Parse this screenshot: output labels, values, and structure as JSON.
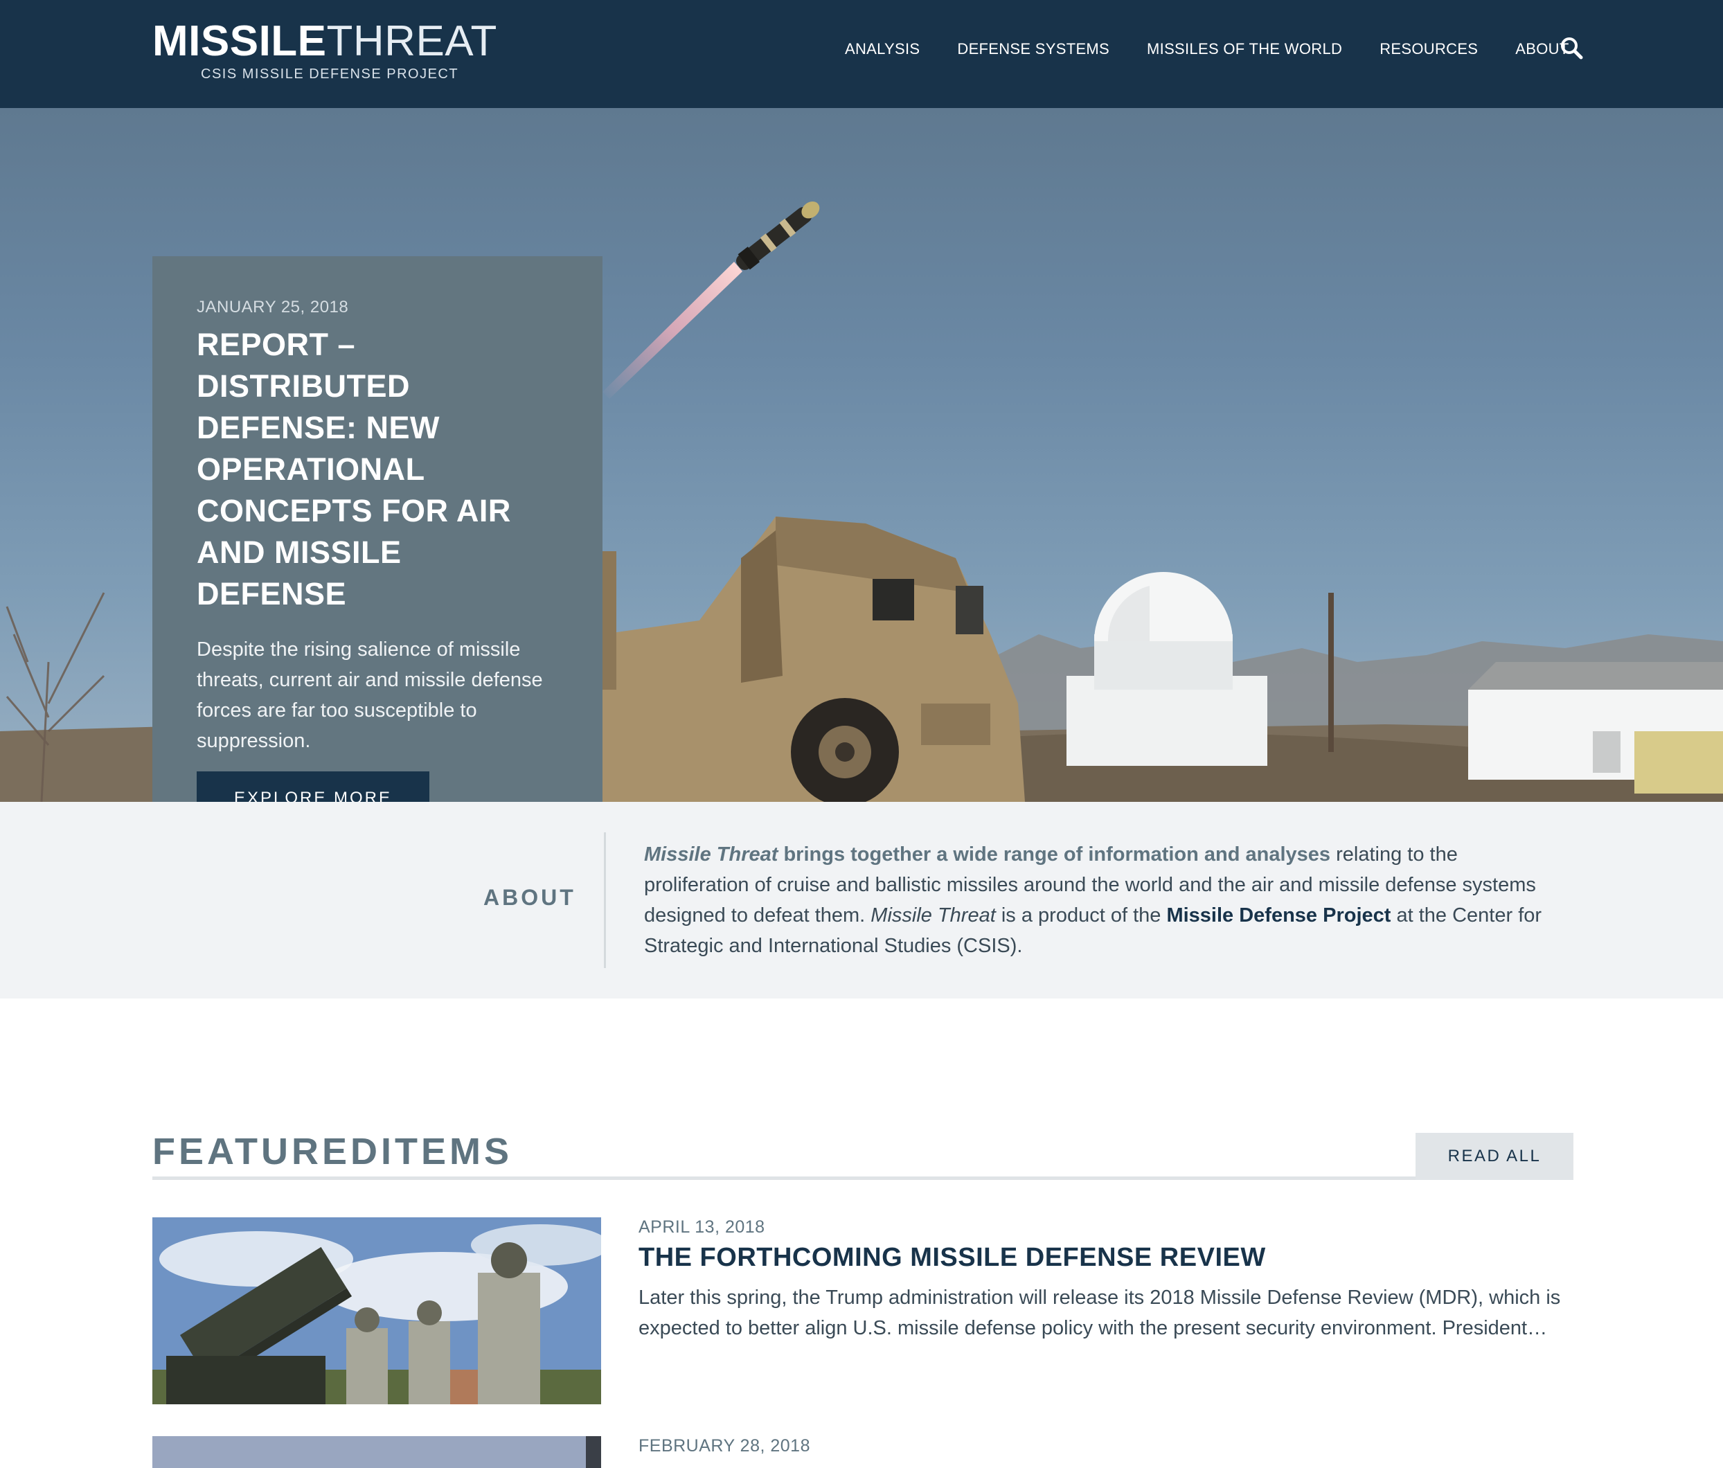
{
  "header": {
    "logo_bold": "MISSILE",
    "logo_light": "THREAT",
    "logo_sub": "CSIS MISSILE DEFENSE PROJECT",
    "nav": [
      "ANALYSIS",
      "DEFENSE SYSTEMS",
      "MISSILES OF THE WORLD",
      "RESOURCES",
      "ABOUT"
    ],
    "search_icon": "search-icon"
  },
  "hero": {
    "date": "JANUARY 25, 2018",
    "title": "REPORT – DISTRIBUTED DEFENSE: NEW OPERATIONAL CONCEPTS FOR AIR AND MISSILE DEFENSE",
    "description": "Despite the rising salience of missile threats, current air and missile defense forces are far too susceptible to suppression.",
    "button": "EXPLORE MORE"
  },
  "about": {
    "label": "ABOUT",
    "text_part1": "Missile Threat",
    "text_part2": " brings together a wide range of information and analyses",
    "text_part3": " relating to the proliferation of cruise and ballistic missiles around the world and the air and missile defense systems designed to defeat them. ",
    "text_part4": "Missile Threat",
    "text_part5": " is a product of the ",
    "text_link": "Missile Defense Project",
    "text_part6": " at the Center for Strategic and International Studies (CSIS)."
  },
  "featured": {
    "title_bold": "FEATURED",
    "title_light": "ITEMS",
    "read_all": "READ ALL",
    "items": [
      {
        "date": "APRIL 13, 2018",
        "title": "THE FORTHCOMING MISSILE DEFENSE REVIEW",
        "description": "Later this spring, the Trump administration will release its 2018 Missile Defense Review (MDR), which is expected to better align U.S. missile defense policy with the present security environment. President…"
      },
      {
        "date": "FEBRUARY 28, 2018",
        "title": "",
        "description": ""
      }
    ]
  },
  "colors": {
    "navy": "#18334a",
    "slate": "#637680",
    "muted": "#5f7480",
    "light_bg": "#f1f3f5"
  }
}
